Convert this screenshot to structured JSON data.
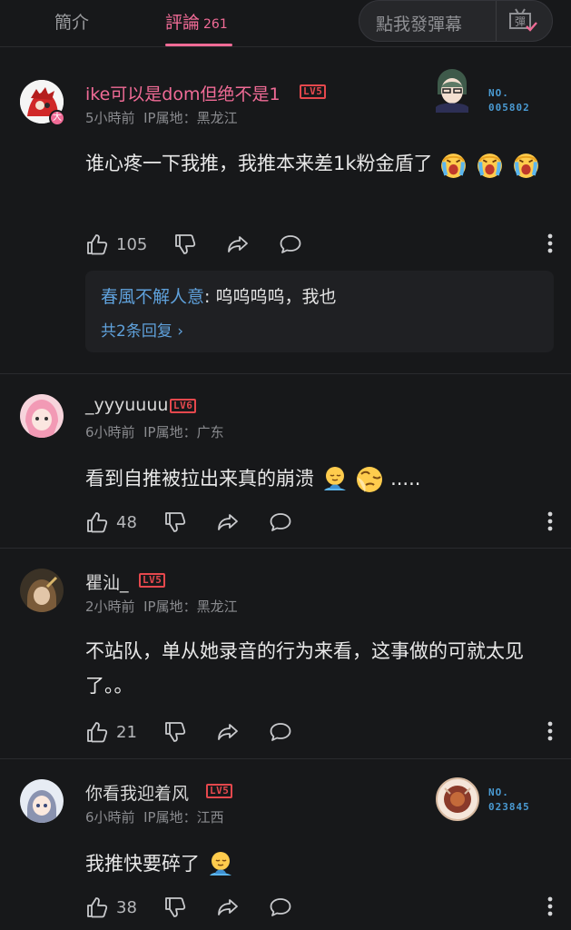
{
  "tabs": {
    "intro": "簡介",
    "comments": "評論",
    "comments_count": "261",
    "danmaku_placeholder": "點我發彈幕",
    "danmaku_btn": "彈"
  },
  "comments": [
    {
      "user": "ike可以是dom但绝不是1",
      "level": "LV5",
      "time": "5小時前",
      "ip": "IP属地：黑龙江",
      "text": "谁心疼一下我推，我推本来差1k粉金盾了",
      "likes": "105",
      "badge_no_label": "NO.",
      "badge_no": "005802",
      "avatar_tag": "大",
      "reply": {
        "name": "春風不解人意",
        "text": ": 呜呜呜呜，我也",
        "more": "共2条回复"
      }
    },
    {
      "user": "_yyyuuuu",
      "level": "LV6",
      "time": "6小時前",
      "ip": "IP属地：广东",
      "text": "看到自推被拉出来真的崩溃",
      "text_suffix": ".....",
      "likes": "48"
    },
    {
      "user": "瞿汕_",
      "level": "LV5",
      "time": "2小時前",
      "ip": "IP属地：黑龙江",
      "text": "不站队，单从她录音的行为来看，这事做的可就太见了。。",
      "likes": "21"
    },
    {
      "user": "你看我迎着风",
      "level": "LV5",
      "time": "6小時前",
      "ip": "IP属地：江西",
      "text": "我推快要碎了",
      "likes": "38",
      "badge_no_label": "NO.",
      "badge_no": "023845"
    }
  ],
  "icons": [
    "thumbs-up-icon",
    "thumbs-down-icon",
    "share-icon",
    "reply-icon",
    "more-icon",
    "crying-emoji",
    "sad-emoji",
    "danmaku-icon"
  ],
  "colors": {
    "accent": "#f06b96",
    "level": "#e5484d",
    "link": "#5fa1db",
    "bg": "#17181a"
  }
}
